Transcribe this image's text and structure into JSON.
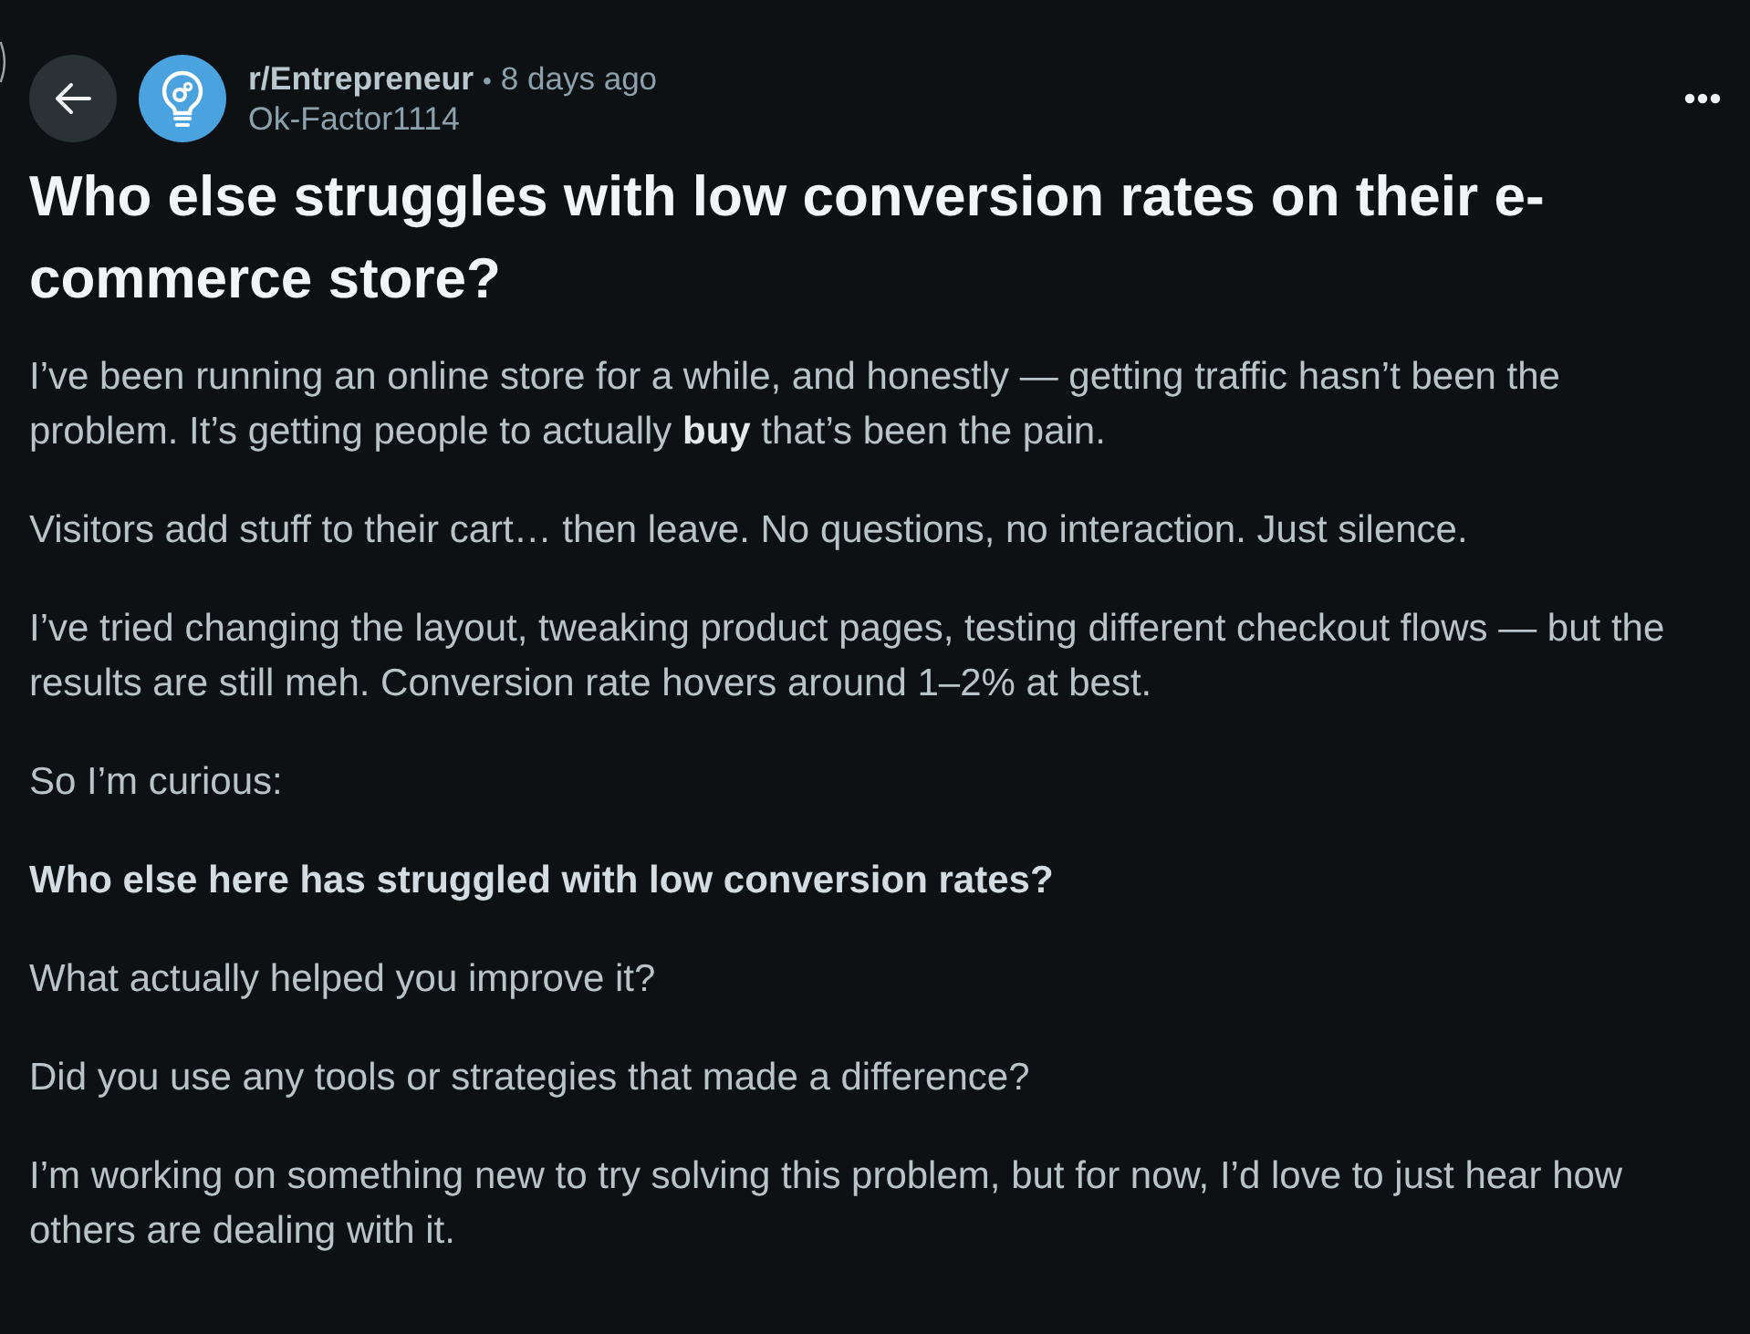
{
  "post_header": {
    "subreddit": "r/Entrepreneur",
    "separator": "•",
    "time": "8 days ago",
    "author": "Ok-Factor1114"
  },
  "title": "Who else struggles with low conversion rates on their e-commerce store?",
  "body": [
    {
      "text": "I’ve been running an online store for a while, and honestly — getting traffic hasn’t been the problem. It’s getting people to actually **buy** that’s been the pain.",
      "bold": false
    },
    {
      "text": "Visitors add stuff to their cart… then leave. No questions, no interaction. Just silence.",
      "bold": false
    },
    {
      "text": "I’ve tried changing the layout, tweaking product pages, testing different checkout flows — but the results are still meh. Conversion rate hovers around 1–2% at best.",
      "bold": false
    },
    {
      "text": "So I’m curious:",
      "bold": false
    },
    {
      "text": "Who else here has struggled with low conversion rates?",
      "bold": true
    },
    {
      "text": "What actually helped you improve it?",
      "bold": false
    },
    {
      "text": "Did you use any tools or strategies that made a difference?",
      "bold": false
    },
    {
      "text": "I’m working on something new to try solving this problem, but for now, I’d love to just hear how others are dealing with it.",
      "bold": false
    }
  ]
}
